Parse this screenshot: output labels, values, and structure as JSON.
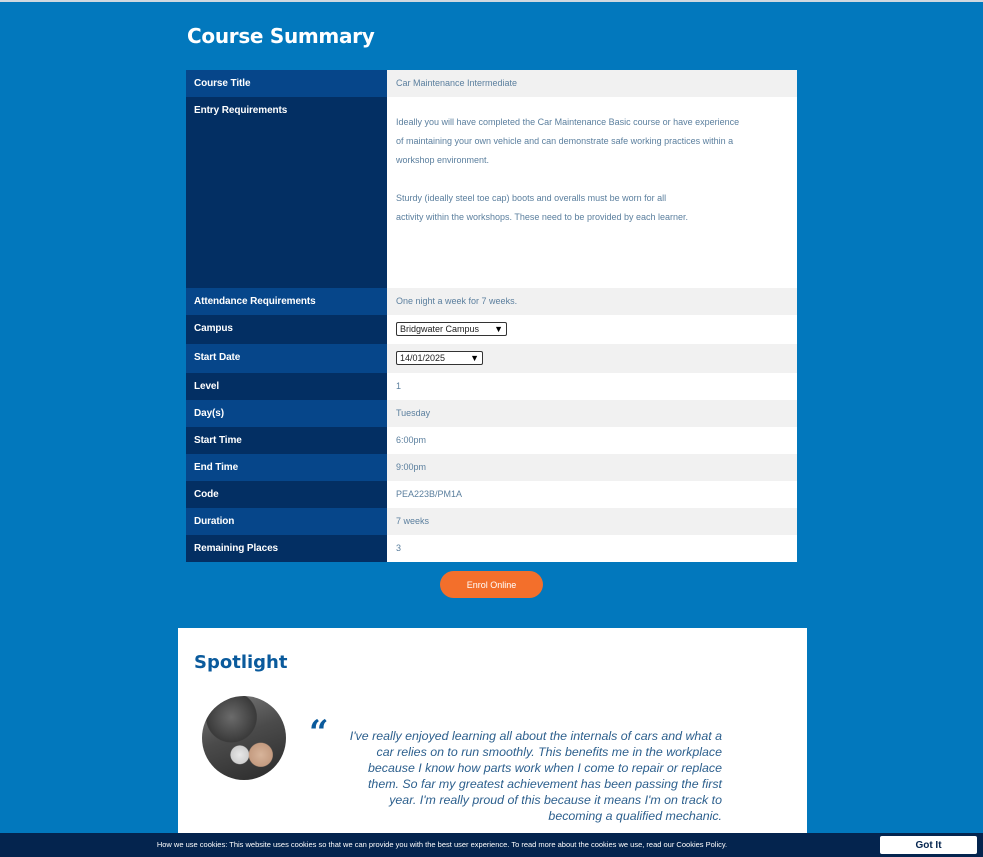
{
  "course_summary": {
    "title": "Course Summary",
    "labels": {
      "course_title": "Course Title",
      "entry_requirements": "Entry Requirements",
      "attendance": "Attendance Requirements",
      "campus": "Campus",
      "start_date": "Start Date",
      "level": "Level",
      "days": "Day(s)",
      "start_time": "Start Time",
      "end_time": "End Time",
      "code": "Code",
      "duration": "Duration",
      "remaining_places": "Remaining Places"
    },
    "values": {
      "course_title": "Car Maintenance Intermediate",
      "entry_requirements": [
        "Ideally you will have completed the Car Maintenance Basic course or have experience of maintaining your own vehicle and can demonstrate safe working practices within a workshop environment.",
        "Sturdy (ideally steel toe cap) boots and overalls must be worn for all activity within the workshops. These need to be provided by each learner."
      ],
      "attendance": "One night a week for 7 weeks.",
      "campus_selected": "Bridgwater Campus",
      "start_date_selected": "14/01/2025",
      "level": "1",
      "days": "Tuesday",
      "start_time": "6:00pm",
      "end_time": "9:00pm",
      "code": "PEA223B/PM1A",
      "duration": "7 weeks",
      "remaining_places": "3"
    },
    "enrol_label": "Enrol Online"
  },
  "spotlight": {
    "title": "Spotlight",
    "quote_mark": "“",
    "quote": "I've really enjoyed learning all about the internals of cars and what a car relies on to run smoothly. This benefits me in the workplace because I know how parts work when I come to repair or replace them. So far my greatest achievement has been passing the first year. I'm really proud of this because it means I'm on track to becoming a qualified mechanic."
  },
  "cookie_bar": {
    "text": "How we use cookies: This website uses cookies so that we can provide you with the best user experience. To read more about the cookies we use, read our Cookies Policy.",
    "button_label": "Got It"
  },
  "colors": {
    "page_background": "#0278bd",
    "label_cell_dark": "#032f63",
    "label_cell_light": "#06468a",
    "enrol_button": "#f36f2b",
    "cookie_bar": "#04244e"
  }
}
